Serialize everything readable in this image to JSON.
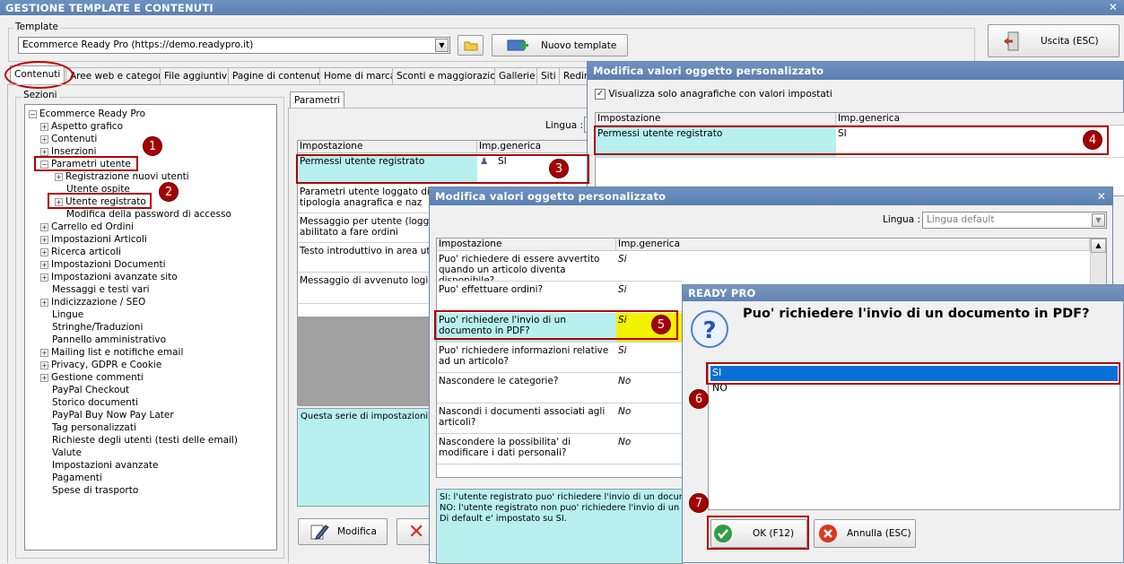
{
  "window": {
    "title": "GESTIONE TEMPLATE E CONTENUTI",
    "close": "✕"
  },
  "template": {
    "group_label": "Template",
    "selected": "Ecommerce Ready Pro (https://demo.readypro.it)",
    "new_button": "Nuovo template",
    "exit_button": "Uscita (ESC)"
  },
  "tabs": [
    "Contenuti",
    "Aree web e categorie",
    "File aggiuntivi",
    "Pagine di contenuti",
    "Home di marca",
    "Sconti e maggiorazioni",
    "Gallerie",
    "Siti",
    "Redire"
  ],
  "sections": {
    "label": "Sezioni",
    "root": "Ecommerce Ready Pro",
    "items": [
      {
        "label": "Aspetto grafico",
        "pm": "+"
      },
      {
        "label": "Contenuti",
        "pm": "+"
      },
      {
        "label": "Inserzioni",
        "pm": "+"
      },
      {
        "label": "Parametri utente",
        "pm": "−"
      },
      {
        "label": "Registrazione nuovi utenti",
        "pm": "+",
        "level": 2
      },
      {
        "label": "Utente ospite",
        "pm": "",
        "level": 2
      },
      {
        "label": "Utente registrato",
        "pm": "+",
        "level": 2
      },
      {
        "label": "Modifica della password di accesso",
        "pm": "",
        "level": 2
      },
      {
        "label": "Carrello ed Ordini",
        "pm": "+"
      },
      {
        "label": "Impostazioni Articoli",
        "pm": "+"
      },
      {
        "label": "Ricerca articoli",
        "pm": "+"
      },
      {
        "label": "Impostazioni Documenti",
        "pm": "+"
      },
      {
        "label": "Impostazioni avanzate sito",
        "pm": "+"
      },
      {
        "label": "Messaggi e testi vari",
        "pm": ""
      },
      {
        "label": "Indicizzazione / SEO",
        "pm": "+"
      },
      {
        "label": "Lingue",
        "pm": ""
      },
      {
        "label": "Stringhe/Traduzioni",
        "pm": ""
      },
      {
        "label": "Pannello amministrativo",
        "pm": ""
      },
      {
        "label": "Mailing list e notifiche email",
        "pm": "+"
      },
      {
        "label": "Privacy, GDPR e Cookie",
        "pm": "+"
      },
      {
        "label": "Gestione commenti",
        "pm": "+"
      },
      {
        "label": "PayPal Checkout",
        "pm": ""
      },
      {
        "label": "Storico documenti",
        "pm": ""
      },
      {
        "label": "PayPal Buy Now Pay Later",
        "pm": ""
      },
      {
        "label": "Tag personalizzati",
        "pm": ""
      },
      {
        "label": "Richieste degli utenti (testi delle email)",
        "pm": ""
      },
      {
        "label": "Valute",
        "pm": ""
      },
      {
        "label": "Impostazioni avanzate",
        "pm": ""
      },
      {
        "label": "Pagamenti",
        "pm": ""
      },
      {
        "label": "Spese di trasporto",
        "pm": ""
      }
    ]
  },
  "params": {
    "tab": "Parametri",
    "lingua_label": "Lingua :",
    "col1": "Impostazione",
    "col2": "Imp.generica",
    "rows": [
      {
        "name": "Permessi utente registrato",
        "value": "SI"
      },
      {
        "name": "Parametri utente loggato dive per tipologia anagrafica e naz",
        "value": ""
      },
      {
        "name": "Messaggio per utente (loggato abilitato a fare ordini",
        "value": ""
      },
      {
        "name": "Testo introduttivo in area ute",
        "value": ""
      },
      {
        "name": "Messaggio di avvenuto login",
        "value": ""
      }
    ],
    "desc": "Questa serie di impostazioni cons",
    "modifica": "Modifica"
  },
  "dialog1": {
    "title": "Modifica valori oggetto personalizzato",
    "checkbox": "Visualizza solo anagrafiche con valori impostati",
    "col1": "Impostazione",
    "col2": "Imp.generica",
    "row_name": "Permessi utente registrato",
    "row_value": "SI"
  },
  "dialog2": {
    "title": "Modifica valori oggetto personalizzato",
    "close": "✕",
    "lingua_label": "Lingua :",
    "lingua_value": "Lingua default",
    "col1": "Impostazione",
    "col2": "Imp.generica",
    "rows": [
      {
        "name": "Puo' richiedere di essere avvertito quando un articolo diventa disponibile?",
        "value": "Si"
      },
      {
        "name": "Puo' effettuare ordini?",
        "value": "Si"
      },
      {
        "name": "Puo' richiedere l'invio di un documento in PDF?",
        "value": "Si"
      },
      {
        "name": "Puo' richiedere informazioni relative ad un articolo?",
        "value": "Si"
      },
      {
        "name": "Nascondere le categorie?",
        "value": "No"
      },
      {
        "name": "Nascondi i documenti associati agli articoli?",
        "value": "No"
      },
      {
        "name": "Nascondere la possibilita' di modificare i dati personali?",
        "value": "No"
      }
    ],
    "info": [
      "SI: l'utente registrato puo' richiedere l'invio di un documen",
      "NO: l'utente registrato non puo' richiedere l'invio di un do",
      "Di default e' impostato su SI."
    ]
  },
  "dialog3": {
    "title": "READY PRO",
    "question": "Puo' richiedere l'invio di un documento in PDF?",
    "options": [
      "SI",
      "NO"
    ],
    "ok": "OK (F12)",
    "cancel": "Annulla (ESC)"
  },
  "markers": [
    "1",
    "2",
    "3",
    "4",
    "5",
    "6",
    "7"
  ],
  "colors": {
    "highlight_red": "#b00000",
    "cyan": "#b8f0f0",
    "selected_blue": "#0a6fd8",
    "yellow": "#f2f200"
  }
}
